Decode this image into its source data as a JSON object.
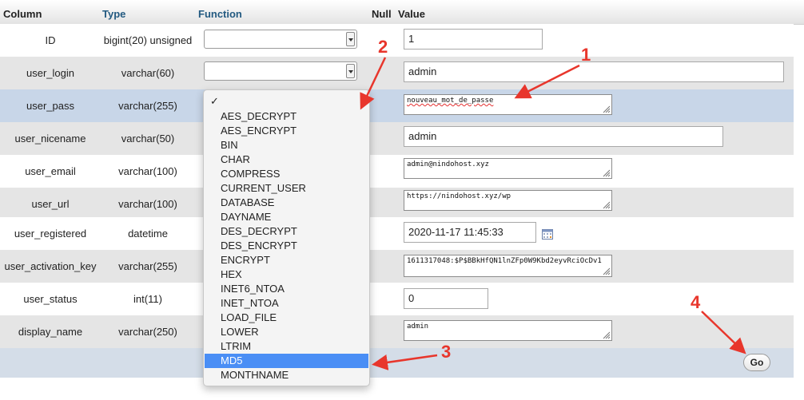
{
  "headers": {
    "column": "Column",
    "type": "Type",
    "function": "Function",
    "null": "Null",
    "value": "Value"
  },
  "rows": [
    {
      "name": "ID",
      "type": "bigint(20) unsigned",
      "value": "1"
    },
    {
      "name": "user_login",
      "type": "varchar(60)",
      "value": "admin"
    },
    {
      "name": "user_pass",
      "type": "varchar(255)",
      "value": "nouveau_mot_de_passe"
    },
    {
      "name": "user_nicename",
      "type": "varchar(50)",
      "value": "admin"
    },
    {
      "name": "user_email",
      "type": "varchar(100)",
      "value": "admin@nindohost.xyz"
    },
    {
      "name": "user_url",
      "type": "varchar(100)",
      "value": "https://nindohost.xyz/wp"
    },
    {
      "name": "user_registered",
      "type": "datetime",
      "value": "2020-11-17 11:45:33"
    },
    {
      "name": "user_activation_key",
      "type": "varchar(255)",
      "value": "1611317048:$P$BBkHfQN1lnZFp0W9Kbd2eyvRciOcDv1"
    },
    {
      "name": "user_status",
      "type": "int(11)",
      "value": "0"
    },
    {
      "name": "display_name",
      "type": "varchar(250)",
      "value": "admin"
    }
  ],
  "dropdown": {
    "check": "✓",
    "options": [
      "AES_DECRYPT",
      "AES_ENCRYPT",
      "BIN",
      "CHAR",
      "COMPRESS",
      "CURRENT_USER",
      "DATABASE",
      "DAYNAME",
      "DES_DECRYPT",
      "DES_ENCRYPT",
      "ENCRYPT",
      "HEX",
      "INET6_NTOA",
      "INET_NTOA",
      "LOAD_FILE",
      "LOWER",
      "LTRIM",
      "MD5",
      "MONTHNAME"
    ],
    "selected": "MD5"
  },
  "go_label": "Go",
  "annotations": [
    "1",
    "2",
    "3",
    "4"
  ],
  "colors": {
    "annotation": "#e8362c",
    "highlight": "#4a8ef5",
    "header_link": "#235a81"
  }
}
